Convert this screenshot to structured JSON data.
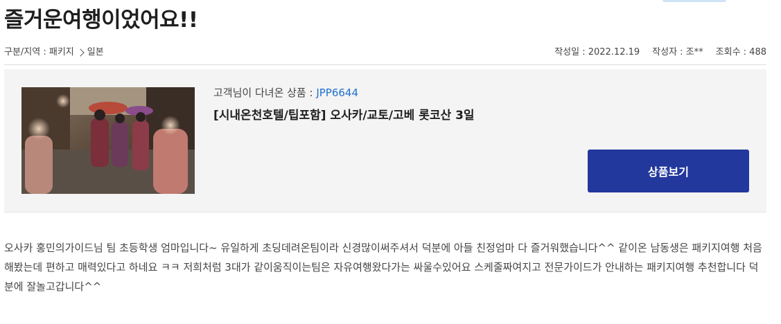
{
  "post": {
    "title": "즐거운여행이었어요!!",
    "breadcrumb": {
      "category_label": "구분/지역 : 패키지",
      "region": "일본"
    },
    "meta": {
      "date": "작성일 : 2022.12.19",
      "author": "작성자 : 조**",
      "views": "조회수 : 488"
    }
  },
  "product": {
    "label": "고객님이 다녀온 상품 : ",
    "code": "JPP6644",
    "name": "[시내온천호텔/팁포함] 오사카/교토/고베 롯코산 3일",
    "image_icon": "kyoto-kimono-street-photo",
    "button_label": "상품보기",
    "button_color": "#23389c"
  },
  "review": {
    "body": "오사카 홍민의가이드님 팀 초등학생 엄마입니다~ 유일하게 초딩데려온팀이라 신경많이써주셔서 덕분에 아들  친정엄마 다 즐거워했습니다^^     같이온 남동생은 패키지여행 처음해봤는데 편하고 매력있다고 하네요 ㅋㅋ 저희처럼 3대가 같이움직이는팀은 자유여행왔다가는 싸울수있어요  스케줄짜여지고 전문가이드가 안내하는 패키지여행 추천합니다 덕분에 잘놀고갑니다^^"
  },
  "colors": {
    "accent_link": "#1f6fd1",
    "box_background": "#f4f4f4"
  }
}
